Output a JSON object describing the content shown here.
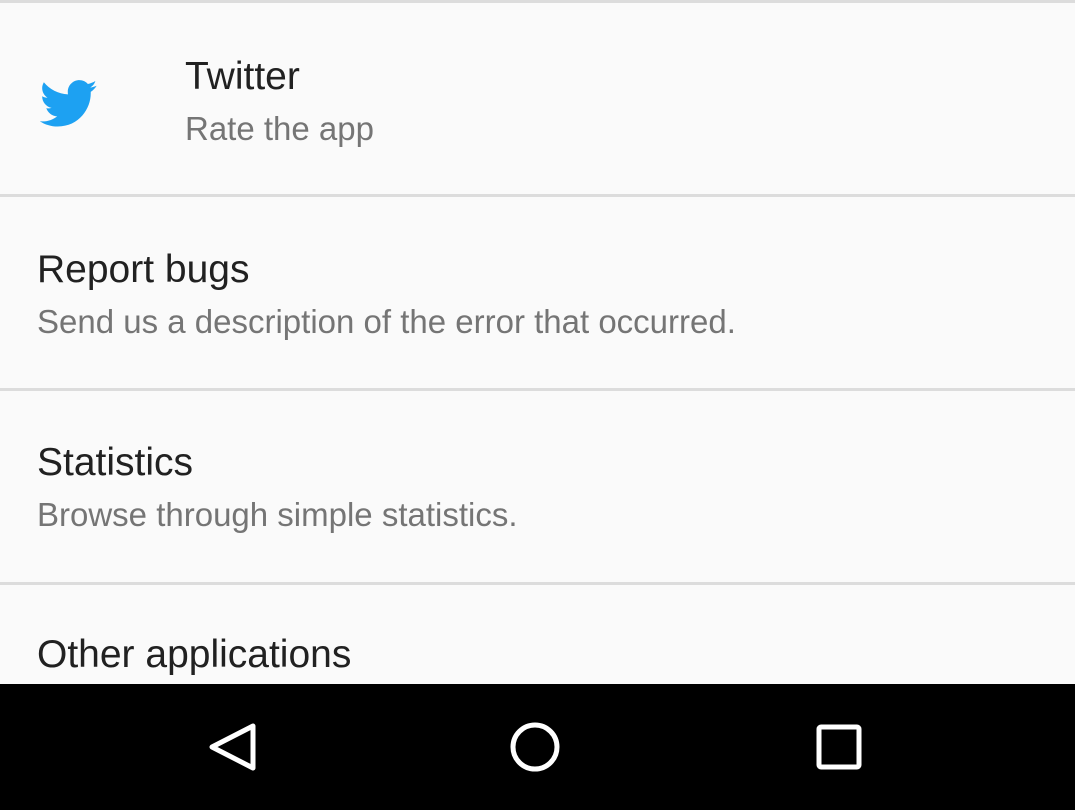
{
  "items": [
    {
      "title": "Twitter",
      "summary": "Rate the app",
      "icon": "twitter-bird-icon"
    },
    {
      "title": "Report bugs",
      "summary": "Send us a description of the error that occurred."
    },
    {
      "title": "Statistics",
      "summary": "Browse through simple statistics."
    },
    {
      "title": "Other applications",
      "summary": ""
    }
  ],
  "colors": {
    "background": "#fafafa",
    "divider": "#dcdcdc",
    "title": "#212121",
    "summary": "#757575",
    "twitter_blue": "#1da1f2",
    "navbar": "#000000"
  },
  "navbar": {
    "buttons": [
      "back-icon",
      "home-icon",
      "recents-icon"
    ]
  }
}
